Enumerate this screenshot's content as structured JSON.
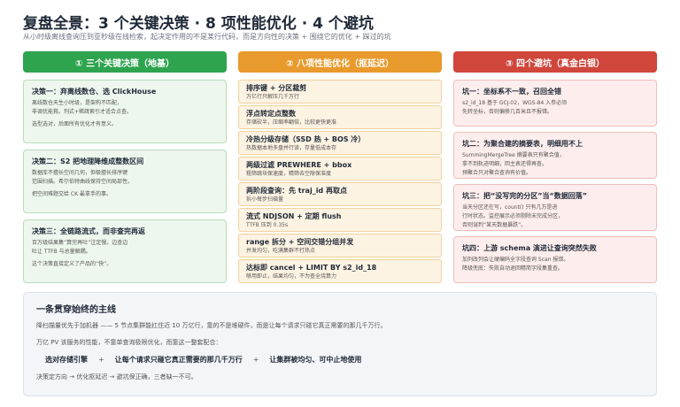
{
  "header": {
    "title": "复盘全景：3 个关键决策 · 8 项性能优化 · 4 个避坑",
    "subtitle": "从小时级离线查询压到亚秒级在线检索，起决定作用的不是某行代码，而是方向性的决策 + 围绕它的优化 + 踩过的坑"
  },
  "columns": {
    "decisions": {
      "header": "① 三个关键决策（地基）",
      "items": [
        {
          "title": "决策一：弃离线数仓、选 ClickHouse",
          "lines": [
            "离线数仓天生小时级，是架构不匹配，",
            "非调优能救。列式+稀疏索引才适合点查。"
          ],
          "extra": "选型选对，后面所有优化才有意义。"
        },
        {
          "title": "决策二：S2 把地理降维成整数区间",
          "lines": [
            "数据库不擅长空间几何，但极擅长排序键",
            "范围扫描。希尔伯特曲线保持空间局部性。"
          ],
          "extra": "把空间难题交给 CK 最拿手的事。"
        },
        {
          "title": "决策三：全链路流式，而非查完再返",
          "lines": [
            "百万级结果集“算完再吐”注定慢。边查边",
            "吐让 TTFB 与总量解耦。"
          ],
          "extra": "这个决策直接定义了产品的“快”。"
        }
      ]
    },
    "optimizations": {
      "header": "② 八项性能优化（抠延迟）",
      "items": [
        {
          "title": "排序键 + 分区裁剪",
          "line": "万亿行只解压几千万行"
        },
        {
          "title": "浮点转定点整数",
          "line": "存储砍半，压缩率翻倍，比较更快更准"
        },
        {
          "title": "冷热分级存储（SSD 热 + BOS 冷）",
          "line": "热数据本地多盘并行读，存量低成本存"
        },
        {
          "title": "两级过滤 PREWHERE + bbox",
          "line": "粗筛跳块保速度，精筛去空隙保准度"
        },
        {
          "title": "两阶段查询：先 traj_id 再取点",
          "line": "拆小每步扫描量"
        },
        {
          "title": "流式 NDJSON + 定期 flush",
          "line": "TTFB 压到 0.35s"
        },
        {
          "title": "range 拆分 + 空间交错分组并发",
          "line": "并发均匀，吃满集群不打热点"
        },
        {
          "title": "达标即 cancel + LIMIT BY s2_id_18",
          "line": "够用即止，结果均匀，不为查全烧算力"
        }
      ]
    },
    "pitfalls": {
      "header": "③ 四个避坑（真金白银）",
      "items": [
        {
          "title": "坑一：坐标系不一致，召回全错",
          "lines": [
            "s2_id_18 基于 GCJ-02，WGS-84 入参必须",
            "先转坐标，否则偏移几百米且不报错。"
          ]
        },
        {
          "title": "坑二：为聚合建的摘要表，明细用不上",
          "lines": [
            "SummingMergeTree 摘要表只有聚合值，",
            "拿不到轨迹明细，回主表还得再查。",
            "预聚合只对聚合查询有价值。"
          ]
        },
        {
          "title": "坑三：把“没写完的分区”当“数据回落”",
          "lines": [
            "当天分区还在写，count() 只有几万是进",
            "行时状态。监控展示必须剔除未完成分区，",
            "否则误判“某天数据暴跌”。"
          ]
        },
        {
          "title": "坑四：上游 schema 演进让查询突然失败",
          "lines": [
            "加列改列会让硬编码全字段查询 Scan 报错。",
            "降级兜底：失败自动退回精简字段集重查。"
          ]
        }
      ]
    }
  },
  "summary": {
    "title": "一条贯穿始终的主线",
    "line1": "降扫描量优先于加机器 —— 5 节点集群能扛住近 10 万亿行，靠的不是堆硬件，而是让每个请求只碰它真正需要的那几千万行。",
    "line2": "万亿 PV 该服务的性能，不靠单查询极限优化，而靠这一整套配合：",
    "chain": [
      "选对存储引擎",
      "让每个请求只碰它真正需要的那几千万行",
      "让集群被均匀、可中止地使用"
    ],
    "plus": "+",
    "line3": "决策定方向 → 优化抠延迟 → 避坑保正确，三者缺一不可。"
  }
}
